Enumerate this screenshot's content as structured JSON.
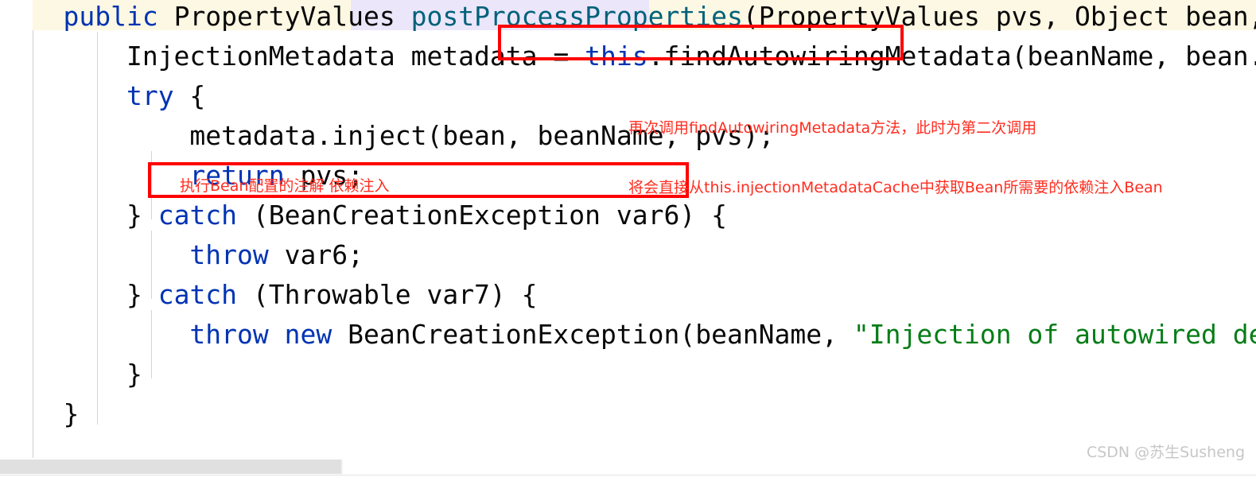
{
  "editor": {
    "language": "java",
    "colors": {
      "keyword": "#0033B3",
      "method": "#00627A",
      "string": "#067D17",
      "text": "#080808",
      "current_line_bg": "#fdf8e3",
      "token_highlight_bg": "#ebe6fa",
      "annotation_red": "#FF0000",
      "annotation_text_red": "#FF2D20",
      "watermark": "#c7c7c7"
    },
    "lines": [
      {
        "n": 1,
        "indent": "    ",
        "segments": [
          {
            "t": "public",
            "c": "kw"
          },
          {
            "t": " PropertyValues ",
            "c": "plain"
          },
          {
            "t": "postProcessProperties",
            "c": "meth"
          },
          {
            "t": "(PropertyValues pvs, Object bean, String b",
            "c": "plain"
          }
        ]
      },
      {
        "n": 2,
        "indent": "        ",
        "segments": [
          {
            "t": "InjectionMetadata metadata = ",
            "c": "plain"
          },
          {
            "t": "this",
            "c": "kw"
          },
          {
            "t": ".findAutowiringMetadata(beanName, bean.getClass(",
            "c": "plain"
          }
        ]
      },
      {
        "n": 3,
        "indent": "        ",
        "segments": [
          {
            "t": "try",
            "c": "kw"
          },
          {
            "t": " {",
            "c": "plain"
          }
        ]
      },
      {
        "n": 4,
        "indent": "            ",
        "segments": [
          {
            "t": "metadata.inject(bean, beanName, pvs);",
            "c": "plain"
          }
        ]
      },
      {
        "n": 5,
        "indent": "            ",
        "segments": [
          {
            "t": "return",
            "c": "kw"
          },
          {
            "t": " pvs;",
            "c": "plain"
          }
        ]
      },
      {
        "n": 6,
        "indent": "        ",
        "segments": [
          {
            "t": "} ",
            "c": "plain"
          },
          {
            "t": "catch",
            "c": "kw"
          },
          {
            "t": " (BeanCreationException var6) {",
            "c": "plain"
          }
        ]
      },
      {
        "n": 7,
        "indent": "            ",
        "segments": [
          {
            "t": "throw",
            "c": "kw"
          },
          {
            "t": " var6;",
            "c": "plain"
          }
        ]
      },
      {
        "n": 8,
        "indent": "        ",
        "segments": [
          {
            "t": "} ",
            "c": "plain"
          },
          {
            "t": "catch",
            "c": "kw"
          },
          {
            "t": " (Throwable var7) {",
            "c": "plain"
          }
        ]
      },
      {
        "n": 9,
        "indent": "            ",
        "segments": [
          {
            "t": "throw",
            "c": "kw"
          },
          {
            "t": " ",
            "c": "plain"
          },
          {
            "t": "new",
            "c": "kw"
          },
          {
            "t": " BeanCreationException(beanName, ",
            "c": "plain"
          },
          {
            "t": "\"Injection of autowired dependencie",
            "c": "str"
          }
        ]
      },
      {
        "n": 10,
        "indent": "        ",
        "segments": [
          {
            "t": "}",
            "c": "plain"
          }
        ]
      },
      {
        "n": 11,
        "indent": "    ",
        "segments": [
          {
            "t": "}",
            "c": "plain"
          }
        ]
      }
    ]
  },
  "annotations": {
    "note_find_metadata": {
      "line1": "再次调用findAutowiringMetadata方法，此时为第二次调用",
      "line2": "将会直接从this.injectionMetadataCache中获取Bean所需要的依赖注入Bean"
    },
    "note_inject": {
      "line1": "执行Bean配置的注解 依赖注入"
    }
  },
  "watermark": {
    "text": "CSDN @苏生Susheng"
  }
}
